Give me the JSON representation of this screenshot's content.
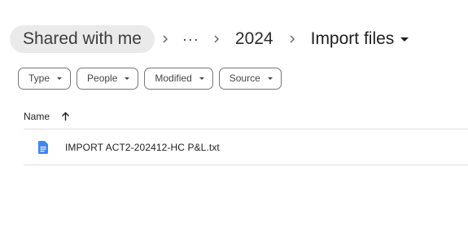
{
  "breadcrumb": {
    "root": "Shared with me",
    "more": "···",
    "folder": "2024",
    "current": "Import files"
  },
  "filters": [
    {
      "label": "Type"
    },
    {
      "label": "People"
    },
    {
      "label": "Modified"
    },
    {
      "label": "Source"
    }
  ],
  "list": {
    "column_name": "Name",
    "sort": "ascending",
    "files": [
      {
        "name": "IMPORT ACT2-202412-HC P&L.txt",
        "icon": "doc-file-icon"
      }
    ]
  },
  "colors": {
    "doc_icon": "#4285f4",
    "chip_border": "#747775",
    "root_chip_bg": "#eaeaea"
  }
}
